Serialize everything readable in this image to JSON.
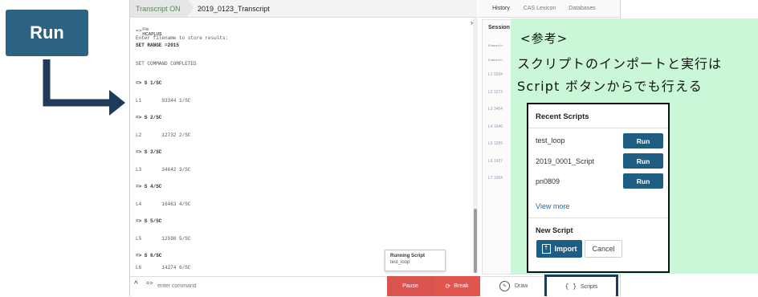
{
  "annotation": {
    "run_label": "Run",
    "note_title": "<参考>",
    "note_line1": "スクリプトのインポートと実行は",
    "note_line2": "Script ボタンからでも行える",
    "arrow_color": "#1f3a5a"
  },
  "transcript": {
    "tab_status": "Transcript ON",
    "tab_name": "2019_0123_Transcript",
    "file_label": "File",
    "file_name": "HCAPLUS",
    "lines": [
      "=>",
      "Enter filename to store results:",
      "SET RANGE =2015",
      "SET COMMAND COMPLETED",
      "=> S 1/SC",
      "L1       93344 1/SC",
      "=> S 2/SC",
      "L2       12732 2/SC",
      "=> S 3/SC",
      "L3       34642 3/SC",
      "=> S 4/SC",
      "L4       16463 4/SC",
      "=> S 5/SC",
      "L5       12598 5/SC",
      "=> S 6/SC",
      "L6       14274 6/SC"
    ],
    "command_placeholder": "enter command",
    "prompt": "=>"
  },
  "running_script": {
    "title": "Running Script",
    "name": "test_loop"
  },
  "controls": {
    "pause": "Pause",
    "break": "Break",
    "draw": "Draw",
    "scripts": "Scripts",
    "scripts_icon": "{ }"
  },
  "right_tabs": {
    "history": "History",
    "cas_lexicon": "CAS Lexicon",
    "databases": "Databases"
  },
  "history": {
    "session": "Session",
    "entered_1": "Entered H",
    "entered_2": "Entered H",
    "items": [
      "L1  9334",
      "L2  1273",
      "L3  3464",
      "L4  1646",
      "L5  1259",
      "L6  1427",
      "L7  1004"
    ]
  },
  "recent_scripts": {
    "title": "Recent Scripts",
    "scripts": [
      {
        "name": "test_loop",
        "run": "Run"
      },
      {
        "name": "2019_0001_Script",
        "run": "Run"
      },
      {
        "name": "pn0809",
        "run": "Run"
      }
    ],
    "view_more": "View more",
    "new_script": "New Script",
    "import": "Import",
    "cancel": "Cancel"
  },
  "colors": {
    "accent": "#1f5d82",
    "break_red": "#e0564e",
    "note_bg": "#c9f7d7",
    "transcript_on_green": "#3f9a3a"
  }
}
